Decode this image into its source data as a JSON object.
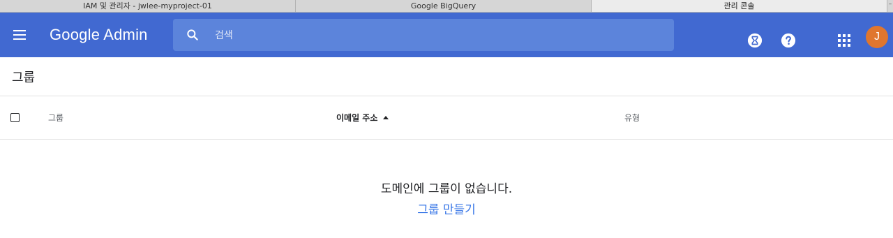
{
  "browser": {
    "tabs": [
      {
        "label": "IAM 및 관리자 - jwlee-myproject-01"
      },
      {
        "label": "Google BigQuery"
      },
      {
        "label": "관리 콘솔"
      }
    ],
    "tab_close_glyph": "–"
  },
  "header": {
    "logo": "Google Admin",
    "search_placeholder": "검색",
    "avatar_initial": "J",
    "colors": {
      "bar": "#4169d1",
      "search": "#5c84db",
      "avatar": "#e0762e"
    },
    "icons": [
      "menu-icon",
      "search-icon",
      "hourglass-icon",
      "help-icon",
      "apps-grid-icon"
    ]
  },
  "page": {
    "title": "그룹"
  },
  "table": {
    "columns": {
      "group": "그룹",
      "email": "이메일 주소",
      "type": "유형"
    },
    "sorted_by": "email",
    "sort_direction": "asc"
  },
  "empty_state": {
    "message": "도메인에 그룹이 없습니다.",
    "action": "그룹 만들기",
    "link_color": "#3b78e7"
  }
}
